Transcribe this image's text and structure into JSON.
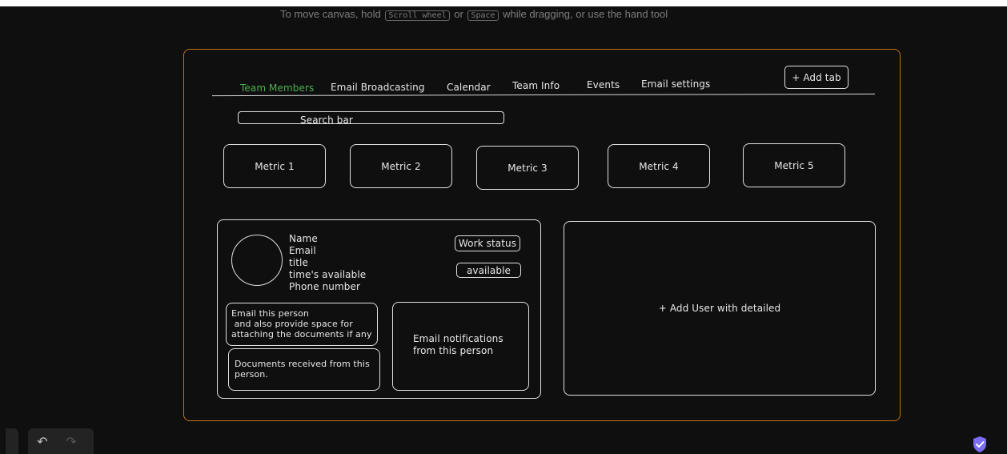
{
  "canvas_hint": {
    "prefix": "To move canvas, hold",
    "key1": "Scroll wheel",
    "middle": "or",
    "key2": "Space",
    "suffix": "while dragging, or use the hand tool"
  },
  "tabs": [
    {
      "label": "Team Members",
      "active": true
    },
    {
      "label": "Email Broadcasting",
      "active": false
    },
    {
      "label": "Calendar",
      "active": false
    },
    {
      "label": "Team Info",
      "active": false
    },
    {
      "label": "Events",
      "active": false
    },
    {
      "label": "Email settings",
      "active": false
    }
  ],
  "add_tab_label": "+ Add tab",
  "search_label": "Search bar",
  "metrics": [
    "Metric 1",
    "Metric 2",
    "Metric 3",
    "Metric 4",
    "Metric 5"
  ],
  "profile": {
    "fields": [
      "Name",
      "Email",
      "title",
      "time's available",
      "Phone number"
    ],
    "work_status_label": "Work status",
    "status_value": "available",
    "email_box": "Email this person\n and also provide space for\nattaching the documents if any",
    "documents_box": "Documents received from this\nperson.",
    "notifications_box": "Email notifications\nfrom this person"
  },
  "add_user_label": "+ Add User with detailed",
  "toolbar": {
    "undo_icon": "undo-icon",
    "redo_icon": "redo-icon"
  },
  "colors": {
    "frame": "#c3731b",
    "active_tab": "#4caf50",
    "shield": "#7b6cf6"
  }
}
